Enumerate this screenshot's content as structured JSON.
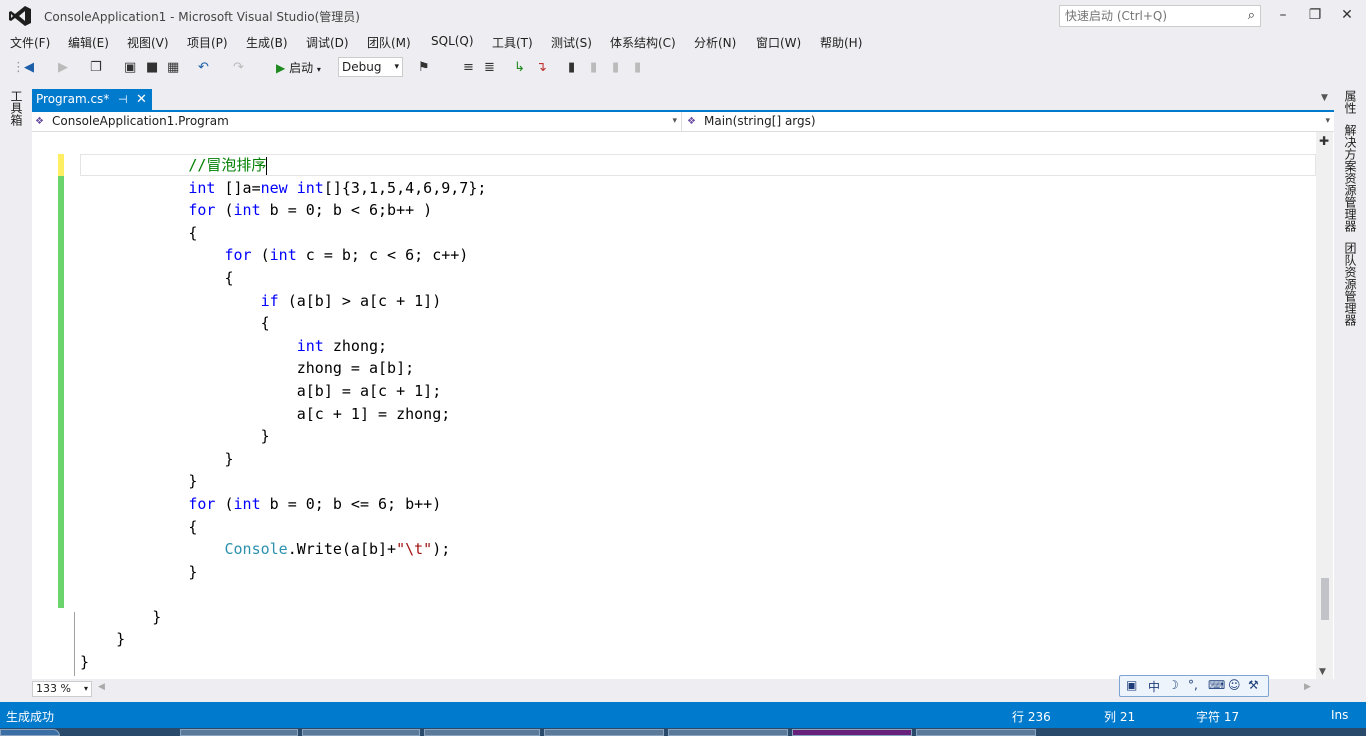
{
  "window": {
    "title": "ConsoleApplication1 - Microsoft Visual Studio(管理员)",
    "quick_launch_placeholder": "快速启动 (Ctrl+Q)"
  },
  "menu": [
    "文件(F)",
    "编辑(E)",
    "视图(V)",
    "项目(P)",
    "生成(B)",
    "调试(D)",
    "团队(M)",
    "SQL(Q)",
    "工具(T)",
    "测试(S)",
    "体系结构(C)",
    "分析(N)",
    "窗口(W)",
    "帮助(H)"
  ],
  "toolbar": {
    "start_label": "启动",
    "configuration": "Debug"
  },
  "left_panel": {
    "toolbox": "工具箱"
  },
  "right_panel": [
    "属性",
    "解决方案资源管理器",
    "团队资源管理器"
  ],
  "document_tab": {
    "name": "Program.cs*"
  },
  "navbar": {
    "class_combo": "ConsoleApplication1.Program",
    "member_combo": "Main(string[] args)"
  },
  "code_lines": [
    "            //冒泡排序",
    "            int []a=new int[]{3,1,5,4,6,9,7};",
    "            for (int b = 0; b < 6;b++ )",
    "            {",
    "                for (int c = b; c < 6; c++)",
    "                {",
    "                    if (a[b] > a[c + 1])",
    "                    {",
    "                        int zhong;",
    "                        zhong = a[b];",
    "                        a[b] = a[c + 1];",
    "                        a[c + 1] = zhong;",
    "                    }",
    "                }",
    "            }",
    "            for (int b = 0; b <= 6; b++)",
    "            {",
    "                Console.Write(a[b]+\"\\t\");",
    "            }",
    "",
    "        }",
    "    }",
    "}"
  ],
  "editor": {
    "zoom": "133 %"
  },
  "ime": {
    "mode": "中"
  },
  "status": {
    "message": "生成成功",
    "line": "行 236",
    "col": "列 21",
    "char": "字符 17",
    "mode": "Ins"
  },
  "colors": {
    "accent": "#007acc",
    "keyword": "#0000ff",
    "comment": "#008000",
    "type": "#2b91af",
    "string": "#a31515"
  }
}
